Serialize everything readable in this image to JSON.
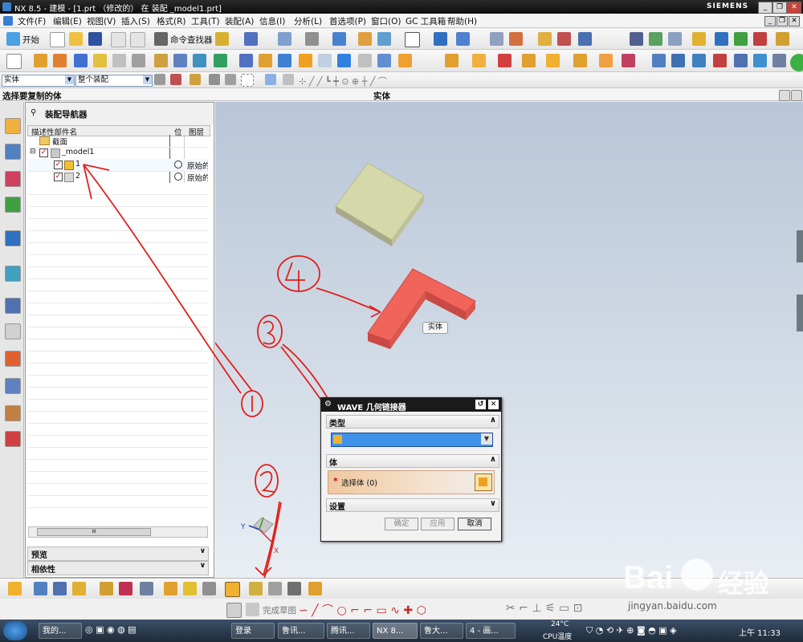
{
  "window": {
    "title": "NX 8.5 - 建模 - [1.prt （修改的） 在 装配 _model1.prt]",
    "brand": "SIEMENS"
  },
  "menu": [
    "文件(F)",
    "编辑(E)",
    "视图(V)",
    "插入(S)",
    "格式(R)",
    "工具(T)",
    "装配(A)",
    "信息(I)",
    "分析(L)",
    "首选项(P)",
    "窗口(O)",
    "GC 工具箱",
    "帮助(H)"
  ],
  "toolbar1": {
    "start_label": "开始",
    "command_finder_label": "命令查找器"
  },
  "selection": {
    "filter_value": "实体",
    "scope_value": "整个装配",
    "prompt": "选择要复制的体",
    "status": "实体"
  },
  "navigator": {
    "title": "装配导航器",
    "columns": {
      "name": "描述性部件名",
      "position": "位",
      "layer": "图层"
    },
    "rows": [
      {
        "label": "截面",
        "position": "",
        "layer": ""
      },
      {
        "label": "_model1",
        "position": "",
        "layer": ""
      },
      {
        "label": "1",
        "position": "",
        "layer": "原始的"
      },
      {
        "label": "2",
        "position": "",
        "layer": "原始的"
      }
    ],
    "scroll_grip": "III",
    "preview_label": "预览",
    "dependency_label": "相依性"
  },
  "graphics": {
    "body_tag": "实体",
    "axis_x": "X",
    "axis_y": "Y",
    "annotations": [
      "1",
      "2",
      "3",
      "4"
    ]
  },
  "dialog": {
    "title": "WAVE 几何链接器",
    "type_section": "类型",
    "body_section": "体",
    "select_body_label": "选择体 (0)",
    "settings_section": "设置",
    "ok_label": "确定",
    "apply_label": "应用",
    "cancel_label": "取消"
  },
  "sketch_bar": {
    "finish_sketch_label": "完成草图"
  },
  "taskbar": {
    "items": [
      "我的...",
      "登录",
      "鲁讯...",
      "腾讯...",
      "NX 8...",
      "鲁大...",
      "4 - 画..."
    ],
    "temperature": "24°C",
    "cpu_label": "CPU温度",
    "clock": "上午 11:33"
  },
  "watermark": {
    "site": "jingyan.baidu.com"
  },
  "colors": {
    "red_body": "#f0645a",
    "green_plate": "#d5d8a8",
    "annotation_ink": "#e0201c",
    "highlight_blue": "#3f92e8"
  }
}
